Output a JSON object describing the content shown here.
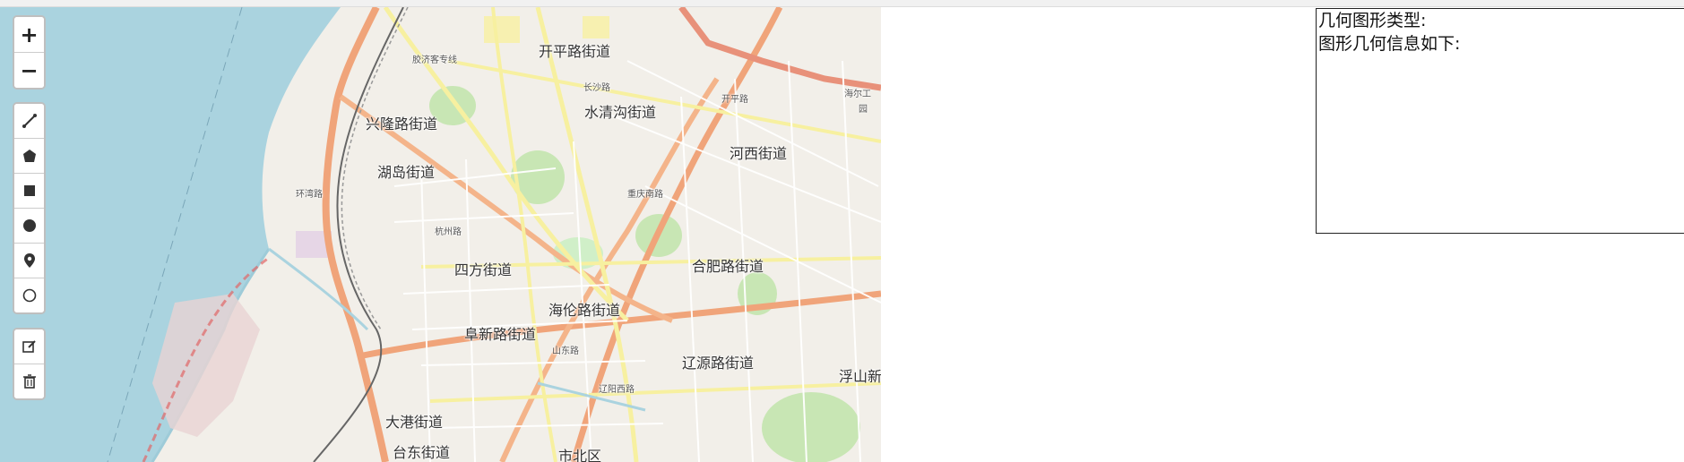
{
  "map": {
    "labels": {
      "kaiping": "开平路街道",
      "shuiqinggou": "水清沟街道",
      "xinglong": "兴隆路街道",
      "hudao": "湖岛街道",
      "hexi": "河西街道",
      "sifang": "四方街道",
      "hefei": "合肥路街道",
      "hailun": "海伦路街道",
      "fuxin": "阜新路街道",
      "liaoyuan": "辽源路街道",
      "fushanxin": "浮山新",
      "dagang": "大港街道",
      "taidong": "台东街道",
      "shibei": "市北区",
      "haier": "海尔工",
      "yuan": "园"
    },
    "roads": {
      "changsha": "长沙路",
      "kaiping_rd": "开平路",
      "shandong": "山东路",
      "liaoyang_w": "辽阳西路",
      "hangzhou": "杭州路",
      "chongqing_n": "重庆南路",
      "jiaozhou_exp": "胶济客专线",
      "huanwan": "环湾路"
    }
  },
  "toolbar": {
    "zoom_in": "+",
    "zoom_out": "−"
  },
  "info": {
    "type_label": "几何图形类型:",
    "geometry_label": "图形几何信息如下:"
  }
}
